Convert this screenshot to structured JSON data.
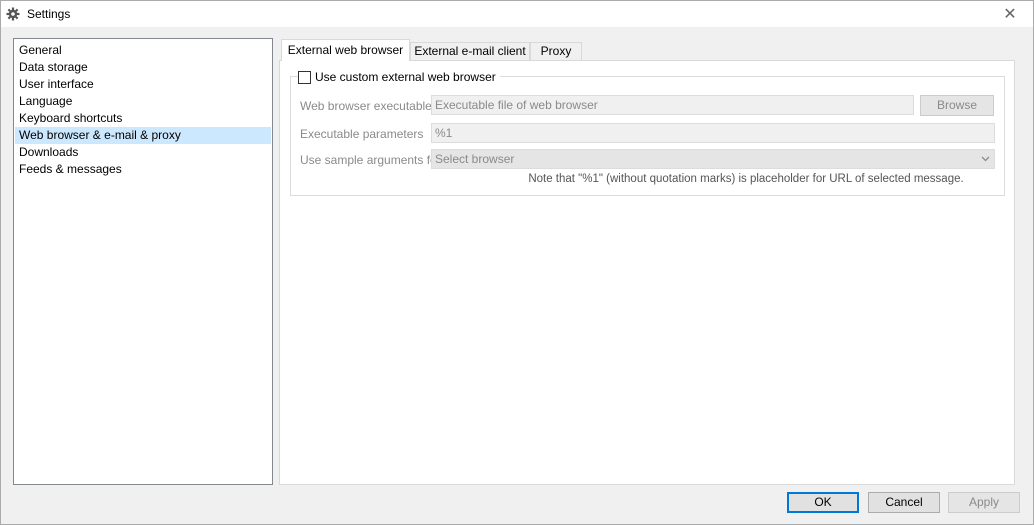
{
  "window": {
    "title": "Settings",
    "icon": "gear-icon",
    "close_symbol": "✕"
  },
  "sidebar": {
    "items": [
      {
        "label": "General"
      },
      {
        "label": "Data storage"
      },
      {
        "label": "User interface"
      },
      {
        "label": "Language"
      },
      {
        "label": "Keyboard shortcuts"
      },
      {
        "label": "Web browser & e-mail & proxy",
        "selected": true
      },
      {
        "label": "Downloads"
      },
      {
        "label": "Feeds & messages"
      }
    ]
  },
  "tabs": [
    {
      "label": "External web browser",
      "active": true
    },
    {
      "label": "External e-mail client"
    },
    {
      "label": "Proxy"
    }
  ],
  "browser_tab": {
    "custom_checkbox_label": "Use custom external web browser",
    "custom_checkbox_checked": false,
    "executable_label": "Web browser executable",
    "executable_placeholder": "Executable file of web browser",
    "browse_label": "Browse",
    "parameters_label": "Executable parameters",
    "parameters_value": "%1",
    "sample_args_label": "Use sample arguments for",
    "sample_args_selected": "Select browser",
    "note": "Note that \"%1\" (without quotation marks) is placeholder for URL of selected message."
  },
  "footer": {
    "ok_label": "OK",
    "cancel_label": "Cancel",
    "apply_label": "Apply"
  },
  "colors": {
    "selection": "#cce8ff",
    "default_button_border": "#0078d7"
  }
}
